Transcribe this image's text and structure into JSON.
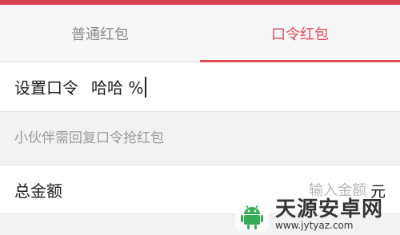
{
  "tabs": [
    {
      "label": "普通红包",
      "active": false
    },
    {
      "label": "口令红包",
      "active": true
    }
  ],
  "command": {
    "label": "设置口令",
    "value": "哈哈 %"
  },
  "hint": "小伙伴需回复口令抢红包",
  "amount": {
    "label": "总金额",
    "placeholder": "输入金额",
    "unit": "元"
  },
  "watermark": {
    "name": "天源安卓网",
    "url": "www.jytyaz.com"
  },
  "colors": {
    "accent": "#e24a57",
    "top_strip": "#d94151",
    "watermark_green": "#2fa84f"
  },
  "icons": {
    "watermark_logo": "android-robot-icon"
  }
}
